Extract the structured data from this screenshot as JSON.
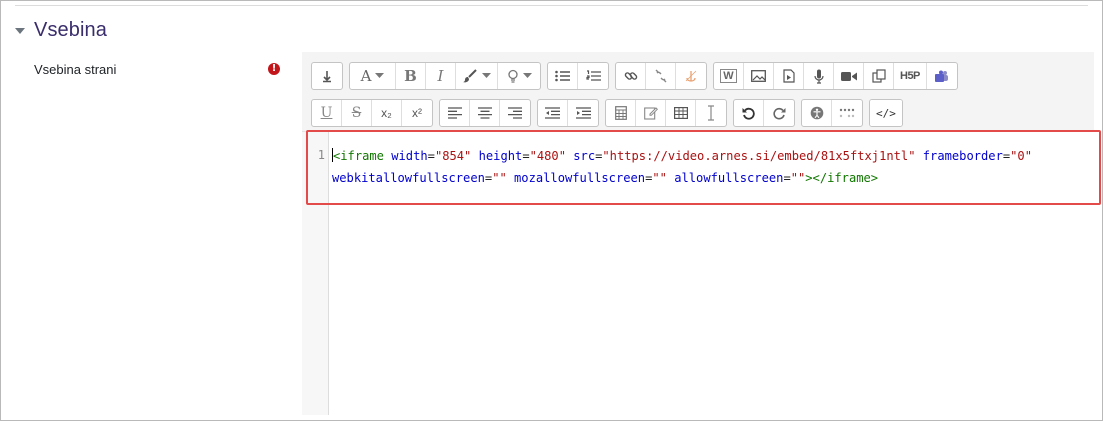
{
  "section": {
    "title": "Vsebina",
    "collapse_icon": "caret-down-icon"
  },
  "field": {
    "label": "Vsebina strani",
    "required_icon": "exclamation-circle-icon",
    "required_symbol": "!",
    "required_color": "#c3161b"
  },
  "toolbar": {
    "row1": [
      [
        "toolbar-toggle-icon"
      ],
      [
        "font-size-icon",
        "bold-icon",
        "italic-icon",
        "text-color-icon",
        "background-color-icon"
      ],
      [
        "bullet-list-icon",
        "numbered-list-icon"
      ],
      [
        "link-icon",
        "unlink-icon",
        "anchor-icon"
      ],
      [
        "word-import-icon",
        "image-icon",
        "media-icon",
        "record-audio-icon",
        "record-video-icon",
        "manage-files-icon",
        "h5p-icon",
        "teams-icon"
      ]
    ],
    "row2": [
      [
        "underline-icon",
        "strikethrough-icon",
        "subscript-icon",
        "superscript-icon"
      ],
      [
        "align-left-icon",
        "align-center-icon",
        "align-right-icon"
      ],
      [
        "outdent-icon",
        "indent-icon"
      ],
      [
        "equation-icon",
        "special-char-icon",
        "table-icon",
        "clear-formatting-icon"
      ],
      [
        "undo-icon",
        "redo-icon"
      ],
      [
        "accessibility-checker-icon",
        "screenreader-helper-icon"
      ],
      [
        "html-source-icon"
      ]
    ],
    "bold_label": "B",
    "italic_label": "I",
    "font_label": "A",
    "underline_label": "U",
    "strike_label": "S",
    "subscript_label": "x₂",
    "superscript_label": "x²",
    "h5p_label": "H5P",
    "source_label": "</>",
    "word_label": "W"
  },
  "code_editor": {
    "line_number": "1",
    "tokens": [
      {
        "type": "tag",
        "text": "<iframe"
      },
      {
        "type": "plain",
        "text": " "
      },
      {
        "type": "attr",
        "text": "width"
      },
      {
        "type": "plain",
        "text": "="
      },
      {
        "type": "str",
        "text": "\"854\""
      },
      {
        "type": "plain",
        "text": " "
      },
      {
        "type": "attr",
        "text": "height"
      },
      {
        "type": "plain",
        "text": "="
      },
      {
        "type": "str",
        "text": "\"480\""
      },
      {
        "type": "plain",
        "text": " "
      },
      {
        "type": "attr",
        "text": "src"
      },
      {
        "type": "plain",
        "text": "="
      },
      {
        "type": "str",
        "text": "\"https://video.arnes.si/embed/81x5ftxj1ntl\""
      },
      {
        "type": "plain",
        "text": " "
      },
      {
        "type": "attr",
        "text": "frameborder"
      },
      {
        "type": "plain",
        "text": "="
      },
      {
        "type": "str",
        "text": "\"0\""
      },
      {
        "type": "plain",
        "text": " "
      },
      {
        "type": "attr",
        "text": "webkitallowfullscreen"
      },
      {
        "type": "plain",
        "text": "="
      },
      {
        "type": "str",
        "text": "\"\""
      },
      {
        "type": "plain",
        "text": " "
      },
      {
        "type": "attr",
        "text": "mozallowfullscreen"
      },
      {
        "type": "plain",
        "text": "="
      },
      {
        "type": "str",
        "text": "\"\""
      },
      {
        "type": "plain",
        "text": " "
      },
      {
        "type": "attr",
        "text": "allowfullscreen"
      },
      {
        "type": "plain",
        "text": "="
      },
      {
        "type": "str",
        "text": "\"\""
      },
      {
        "type": "tag",
        "text": "></iframe>"
      }
    ]
  },
  "colors": {
    "section_title": "#3a2d6b",
    "highlight_border": "#e34a4a",
    "code_tag": "#117700",
    "code_attr": "#0000cc",
    "code_string": "#aa1111"
  }
}
